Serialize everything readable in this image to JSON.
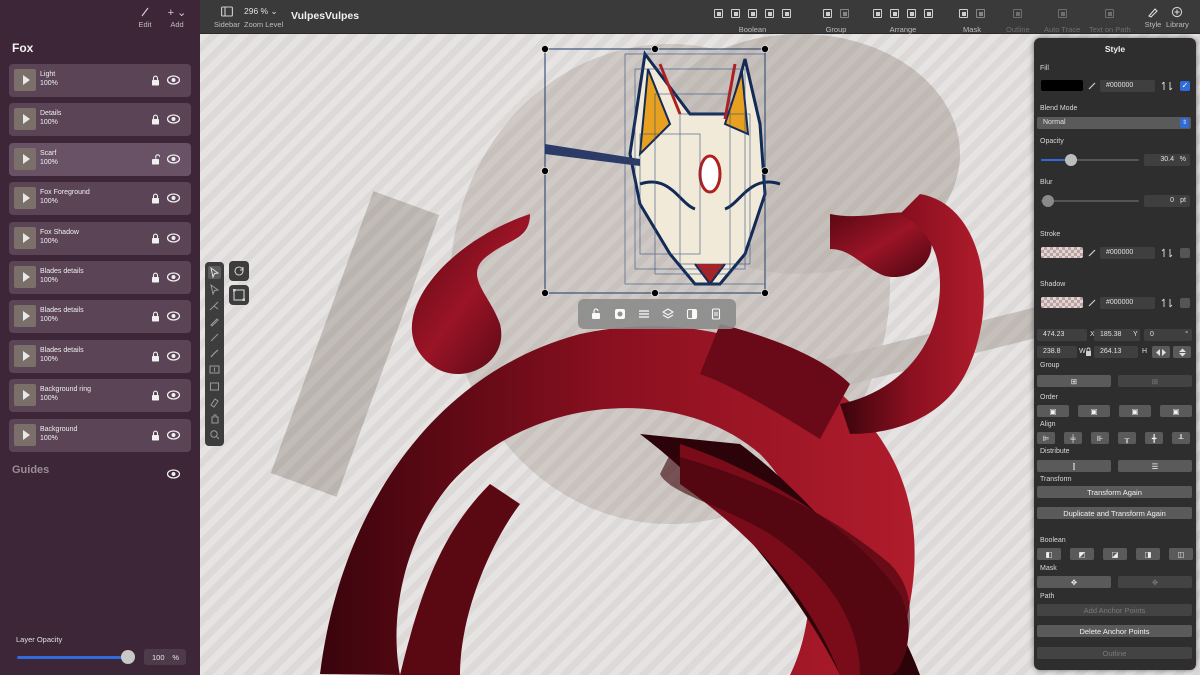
{
  "app": {
    "document_title": "VulpesVulpes",
    "zoom_value": "296 %",
    "zoom_label": "Zoom Level",
    "sidebar_label": "Sidebar"
  },
  "sidebar_top": {
    "edit_label": "Edit",
    "add_label": "Add"
  },
  "toolbar": {
    "boolean_label": "Boolean",
    "group_label": "Group",
    "arrange_label": "Arrange",
    "mask_label": "Mask",
    "outline_label": "Outline",
    "auto_trace_label": "Auto Trace",
    "text_on_path_label": "Text on Path",
    "style_label": "Style",
    "library_label": "Library"
  },
  "layers_panel": {
    "title": "Fox",
    "layers": [
      {
        "name": "Light",
        "opacity": "100%",
        "locked": true
      },
      {
        "name": "Details",
        "opacity": "100%",
        "locked": true
      },
      {
        "name": "Scarf",
        "opacity": "100%",
        "locked": false
      },
      {
        "name": "Fox Foreground",
        "opacity": "100%",
        "locked": true
      },
      {
        "name": "Fox Shadow",
        "opacity": "100%",
        "locked": true
      },
      {
        "name": "Blades details",
        "opacity": "100%",
        "locked": true
      },
      {
        "name": "Blades details",
        "opacity": "100%",
        "locked": true
      },
      {
        "name": "Blades details",
        "opacity": "100%",
        "locked": true
      },
      {
        "name": "Background ring",
        "opacity": "100%",
        "locked": true
      },
      {
        "name": "Background",
        "opacity": "100%",
        "locked": true
      }
    ],
    "guides_title": "Guides",
    "layer_opacity_label": "Layer Opacity",
    "layer_opacity_value": "100",
    "layer_opacity_unit": "%",
    "layer_opacity_level": 1.0
  },
  "style_panel": {
    "title": "Style",
    "fill_label": "Fill",
    "fill_color": "#000000",
    "fill_hex": "#000000",
    "blend_mode_label": "Blend Mode",
    "blend_mode_value": "Normal",
    "opacity_label": "Opacity",
    "opacity_value": "30.4",
    "opacity_unit": "%",
    "opacity_level": 0.304,
    "blur_label": "Blur",
    "blur_value": "0",
    "blur_unit": "pt",
    "stroke_label": "Stroke",
    "stroke_hex": "#000000",
    "shadow_label": "Shadow",
    "shadow_hex": "#000000",
    "x_value": "474.23",
    "x_axis": "X",
    "y_value": "185.38",
    "y_axis": "Y",
    "rotation_value": "0",
    "rotation_unit": "°",
    "w_value": "238.8",
    "w_axis": "W",
    "h_value": "264.13",
    "h_axis": "H",
    "group_label": "Group",
    "order_label": "Order",
    "align_label": "Align",
    "distribute_label": "Distribute",
    "transform_label": "Transform",
    "transform_again": "Transform Again",
    "duplicate_transform": "Duplicate and Transform Again",
    "boolean_label": "Boolean",
    "mask_label": "Mask",
    "path_label": "Path",
    "add_anchor": "Add Anchor Points",
    "delete_anchor": "Delete Anchor Points",
    "outline_btn": "Outline"
  },
  "colors": {
    "sidebar_bg": "#3d2638",
    "accent_blue": "#2f6cd9",
    "ribbon_red": "#8a0f1e"
  }
}
